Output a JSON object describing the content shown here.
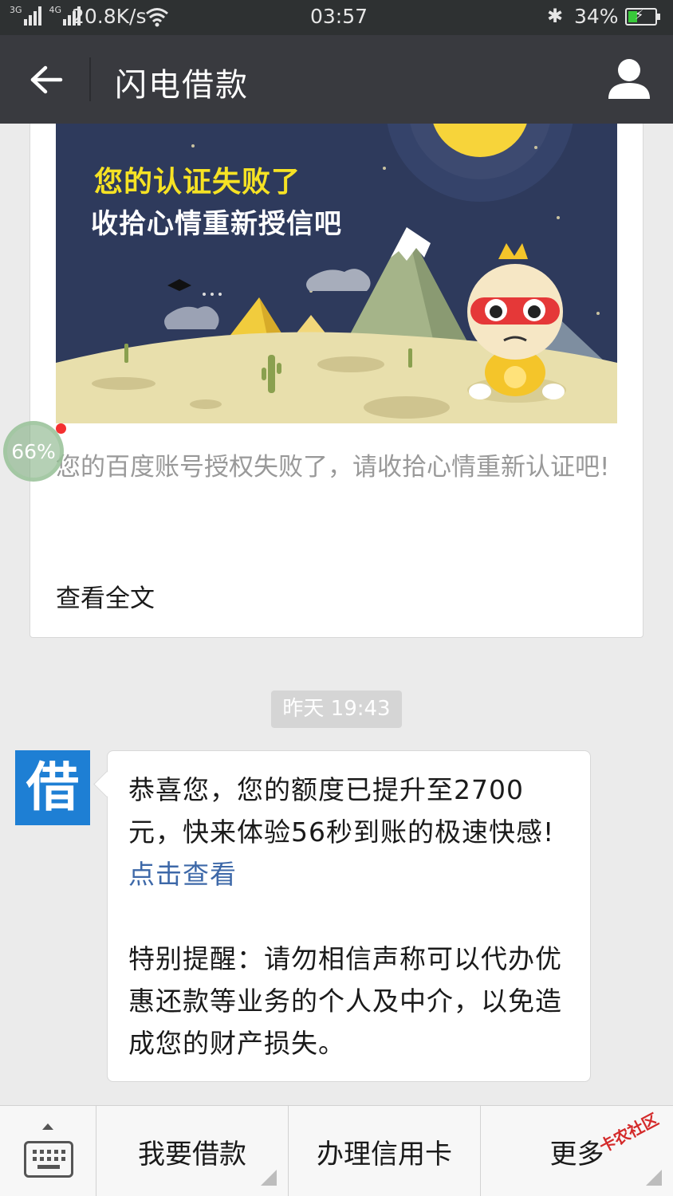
{
  "status_bar": {
    "network_a": "3G",
    "network_b": "4G",
    "speed": "20.8K/s",
    "time": "03:57",
    "battery": "34%",
    "battery_level": 0.34
  },
  "header": {
    "title": "闪电借款",
    "back_icon": "back-arrow-icon",
    "user_icon": "user-profile-icon"
  },
  "article_card": {
    "banner_line1": "您的认证失败了",
    "banner_line2": "收拾心情重新授信吧",
    "description": "您的百度账号授权失败了，请收拾心情重新认证吧!",
    "read_more": "查看全文"
  },
  "floating_ball": {
    "percent": "66%"
  },
  "conversation": {
    "timestamp": "昨天 19:43",
    "avatar_char": "借",
    "message_part1": "恭喜您，您的额度已提升至2700元，快来体验56秒到账的极速快感! ",
    "message_link": "点击查看",
    "message_part2": "特别提醒：请勿相信声称可以代办优惠还款等业务的个人及中介，以免造成您的财产损失。"
  },
  "bottom_menu": {
    "keyboard_icon": "keyboard-icon",
    "items": [
      {
        "label": "我要借款"
      },
      {
        "label": "办理信用卡"
      },
      {
        "label": "更多"
      }
    ]
  },
  "watermark": "卡农社区",
  "colors": {
    "titlebar": "#393a3f",
    "statusbar": "#2e3132",
    "background": "#ebebeb",
    "link": "#3d68a8",
    "avatar": "#1e7fd4",
    "banner_title": "#f6e224"
  }
}
